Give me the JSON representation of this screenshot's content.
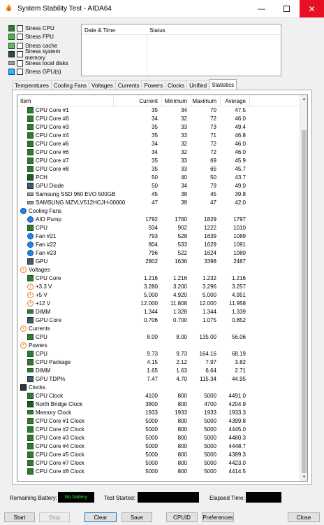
{
  "window": {
    "title": "System Stability Test - AIDA64"
  },
  "stress_options": [
    {
      "label": "Stress CPU",
      "icon": "cpu-chip-icon",
      "checked": false
    },
    {
      "label": "Stress FPU",
      "icon": "fpu-chip-icon",
      "checked": false
    },
    {
      "label": "Stress cache",
      "icon": "cache-chip-icon",
      "checked": false
    },
    {
      "label": "Stress system memory",
      "icon": "memory-module-icon",
      "checked": false
    },
    {
      "label": "Stress local disks",
      "icon": "disk-drive-icon",
      "checked": false
    },
    {
      "label": "Stress GPU(s)",
      "icon": "monitor-icon",
      "checked": false
    }
  ],
  "log": {
    "col_date": "Date & Time",
    "col_status": "Status"
  },
  "tabs": [
    "Temperatures",
    "Cooling Fans",
    "Voltages",
    "Currents",
    "Powers",
    "Clocks",
    "Unified",
    "Statistics"
  ],
  "active_tab": "Statistics",
  "table": {
    "headers": {
      "item": "Item",
      "current": "Current",
      "minimum": "Minimum",
      "maximum": "Maximum",
      "average": "Average"
    },
    "rows": [
      {
        "type": "item",
        "icon": "cpu",
        "name": "CPU Core #1",
        "cur": "35",
        "min": "34",
        "max": "70",
        "avg": "47.5"
      },
      {
        "type": "item",
        "icon": "cpu",
        "name": "CPU Core #6",
        "cur": "34",
        "min": "32",
        "max": "72",
        "avg": "46.0"
      },
      {
        "type": "item",
        "icon": "cpu",
        "name": "CPU Core #3",
        "cur": "35",
        "min": "33",
        "max": "73",
        "avg": "49.4"
      },
      {
        "type": "item",
        "icon": "cpu",
        "name": "CPU Core #4",
        "cur": "35",
        "min": "33",
        "max": "71",
        "avg": "46.8"
      },
      {
        "type": "item",
        "icon": "cpu",
        "name": "CPU Core #6",
        "cur": "34",
        "min": "32",
        "max": "72",
        "avg": "46.0"
      },
      {
        "type": "item",
        "icon": "cpu",
        "name": "CPU Core #6",
        "cur": "34",
        "min": "32",
        "max": "72",
        "avg": "46.0"
      },
      {
        "type": "item",
        "icon": "cpu",
        "name": "CPU Core #7",
        "cur": "35",
        "min": "33",
        "max": "69",
        "avg": "45.9"
      },
      {
        "type": "item",
        "icon": "cpu",
        "name": "CPU Core #8",
        "cur": "35",
        "min": "33",
        "max": "65",
        "avg": "45.7"
      },
      {
        "type": "item",
        "icon": "board",
        "name": "PCH",
        "cur": "50",
        "min": "40",
        "max": "50",
        "avg": "43.7"
      },
      {
        "type": "item",
        "icon": "gpu",
        "name": "GPU Diode",
        "cur": "50",
        "min": "34",
        "max": "79",
        "avg": "49.0"
      },
      {
        "type": "item",
        "icon": "disk",
        "name": "Samsung SSD 960 EVO 500GB",
        "cur": "45",
        "min": "38",
        "max": "45",
        "avg": "39.8"
      },
      {
        "type": "item",
        "icon": "disk",
        "name": "SAMSUNG MZVLV512HCJH-00000",
        "cur": "47",
        "min": "39",
        "max": "47",
        "avg": "42.0"
      },
      {
        "type": "group",
        "icon": "fan",
        "name": "Cooling Fans"
      },
      {
        "type": "item",
        "icon": "fan",
        "name": "AIO Pump",
        "cur": "1792",
        "min": "1760",
        "max": "1829",
        "avg": "1797"
      },
      {
        "type": "item",
        "icon": "cpu",
        "name": "CPU",
        "cur": "934",
        "min": "902",
        "max": "1222",
        "avg": "1010"
      },
      {
        "type": "item",
        "icon": "fan",
        "name": "Fan #21",
        "cur": "793",
        "min": "528",
        "max": "1639",
        "avg": "1089"
      },
      {
        "type": "item",
        "icon": "fan",
        "name": "Fan #22",
        "cur": "804",
        "min": "533",
        "max": "1629",
        "avg": "1091"
      },
      {
        "type": "item",
        "icon": "fan",
        "name": "Fan #23",
        "cur": "796",
        "min": "522",
        "max": "1624",
        "avg": "1080"
      },
      {
        "type": "item",
        "icon": "gpu",
        "name": "GPU",
        "cur": "2802",
        "min": "1636",
        "max": "3398",
        "avg": "2487"
      },
      {
        "type": "group",
        "icon": "volt",
        "name": "Voltages"
      },
      {
        "type": "item",
        "icon": "cpu",
        "name": "CPU Core",
        "cur": "1.216",
        "min": "1.216",
        "max": "1.232",
        "avg": "1.216"
      },
      {
        "type": "item",
        "icon": "volt",
        "name": "+3.3 V",
        "cur": "3.280",
        "min": "3.200",
        "max": "3.296",
        "avg": "3.257"
      },
      {
        "type": "item",
        "icon": "volt",
        "name": "+5 V",
        "cur": "5.000",
        "min": "4.920",
        "max": "5.000",
        "avg": "4.951"
      },
      {
        "type": "item",
        "icon": "volt",
        "name": "+12 V",
        "cur": "12.000",
        "min": "11.808",
        "max": "12.000",
        "avg": "11.958"
      },
      {
        "type": "item",
        "icon": "mem",
        "name": "DIMM",
        "cur": "1.344",
        "min": "1.328",
        "max": "1.344",
        "avg": "1.339"
      },
      {
        "type": "item",
        "icon": "gpu",
        "name": "GPU Core",
        "cur": "0.706",
        "min": "0.700",
        "max": "1.075",
        "avg": "0.852"
      },
      {
        "type": "group",
        "icon": "volt",
        "name": "Currents"
      },
      {
        "type": "item",
        "icon": "cpu",
        "name": "CPU",
        "cur": "8.00",
        "min": "8.00",
        "max": "135.00",
        "avg": "56.06"
      },
      {
        "type": "group",
        "icon": "volt",
        "name": "Powers"
      },
      {
        "type": "item",
        "icon": "cpu",
        "name": "CPU",
        "cur": "9.73",
        "min": "9.73",
        "max": "164.16",
        "avg": "68.19"
      },
      {
        "type": "item",
        "icon": "cpu",
        "name": "CPU Package",
        "cur": "4.15",
        "min": "2.12",
        "max": "7.97",
        "avg": "3.82"
      },
      {
        "type": "item",
        "icon": "mem",
        "name": "DIMM",
        "cur": "1.65",
        "min": "1.63",
        "max": "6.64",
        "avg": "2.71"
      },
      {
        "type": "item",
        "icon": "gpu",
        "name": "GPU TDP%",
        "cur": "7.47",
        "min": "4.70",
        "max": "115.34",
        "avg": "44.95"
      },
      {
        "type": "group",
        "icon": "clock",
        "name": "Clocks"
      },
      {
        "type": "item",
        "icon": "cpu",
        "name": "CPU Clock",
        "cur": "4100",
        "min": "800",
        "max": "5000",
        "avg": "4491.0"
      },
      {
        "type": "item",
        "icon": "board",
        "name": "North Bridge Clock",
        "cur": "3800",
        "min": "800",
        "max": "4700",
        "avg": "4204.9"
      },
      {
        "type": "item",
        "icon": "mem",
        "name": "Memory Clock",
        "cur": "1933",
        "min": "1933",
        "max": "1933",
        "avg": "1933.3"
      },
      {
        "type": "item",
        "icon": "cpu",
        "name": "CPU Core #1 Clock",
        "cur": "5000",
        "min": "800",
        "max": "5000",
        "avg": "4399.8"
      },
      {
        "type": "item",
        "icon": "cpu",
        "name": "CPU Core #2 Clock",
        "cur": "5000",
        "min": "800",
        "max": "5000",
        "avg": "4445.0"
      },
      {
        "type": "item",
        "icon": "cpu",
        "name": "CPU Core #3 Clock",
        "cur": "5000",
        "min": "800",
        "max": "5000",
        "avg": "4480.3"
      },
      {
        "type": "item",
        "icon": "cpu",
        "name": "CPU Core #4 Clock",
        "cur": "5000",
        "min": "800",
        "max": "5000",
        "avg": "4448.7"
      },
      {
        "type": "item",
        "icon": "cpu",
        "name": "CPU Core #5 Clock",
        "cur": "5000",
        "min": "800",
        "max": "5000",
        "avg": "4389.3"
      },
      {
        "type": "item",
        "icon": "cpu",
        "name": "CPU Core #7 Clock",
        "cur": "5000",
        "min": "800",
        "max": "5000",
        "avg": "4423.0"
      },
      {
        "type": "item",
        "icon": "cpu",
        "name": "CPU Core #8 Clock",
        "cur": "5000",
        "min": "800",
        "max": "5000",
        "avg": "4414.5"
      }
    ]
  },
  "status_bar": {
    "battery_label": "Remaining Battery:",
    "battery_value": "No battery",
    "started_label": "Test Started:",
    "elapsed_label": "Elapsed Time:"
  },
  "buttons": {
    "start": "Start",
    "stop": "Stop",
    "clear": "Clear",
    "save": "Save",
    "cpuid": "CPUID",
    "preferences": "Preferences",
    "close": "Close"
  },
  "colors": {
    "battery_text": "#3ee03e",
    "close_button_bg": "#e81123",
    "cpu_icon": "#2e7d32",
    "fan_icon": "#1e88e5",
    "volt_icon": "#e67e22"
  }
}
